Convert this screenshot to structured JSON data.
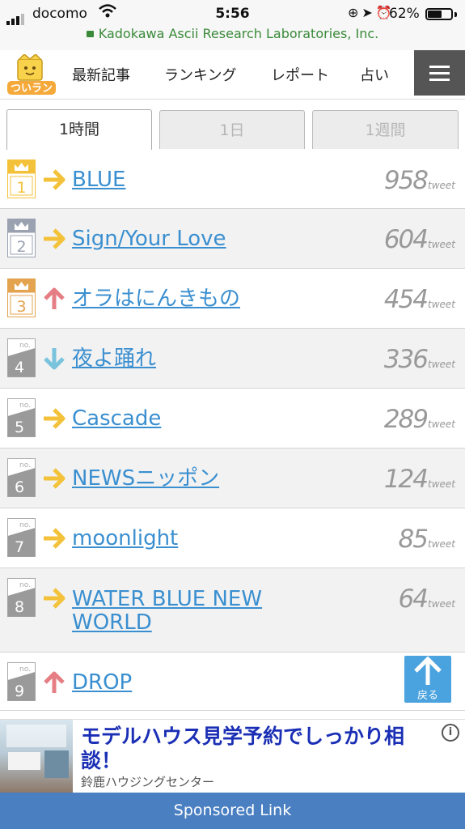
{
  "status_bar": {
    "carrier": "docomo",
    "time": "5:56",
    "battery_percent": "62%",
    "battery_level": 0.62,
    "url": "Kadokawa Ascii Research Laboratories, Inc."
  },
  "nav": {
    "logo_text": "ついラン",
    "items": [
      {
        "label": "最新記事"
      },
      {
        "label": "ランキング"
      },
      {
        "label": "レポート"
      },
      {
        "label": "占い"
      }
    ],
    "menu_icon": "hamburger-icon"
  },
  "tabs": [
    {
      "label": "1時間",
      "active": true
    },
    {
      "label": "1日",
      "active": false
    },
    {
      "label": "1週間",
      "active": false
    }
  ],
  "ranking": {
    "unit": "tweet",
    "rows": [
      {
        "rank": "1",
        "trend": "same",
        "title": "BLUE",
        "count": "958"
      },
      {
        "rank": "2",
        "trend": "same",
        "title": "Sign/Your Love",
        "count": "604"
      },
      {
        "rank": "3",
        "trend": "up",
        "title": "オラはにんきもの",
        "count": "454"
      },
      {
        "rank": "4",
        "trend": "down",
        "title": "夜よ踊れ",
        "count": "336"
      },
      {
        "rank": "5",
        "trend": "same",
        "title": "Cascade",
        "count": "289"
      },
      {
        "rank": "6",
        "trend": "same",
        "title": "NEWSニッポン",
        "count": "124"
      },
      {
        "rank": "7",
        "trend": "same",
        "title": "moonlight",
        "count": "85"
      },
      {
        "rank": "8",
        "trend": "same",
        "title": "WATER BLUE NEW WORLD",
        "count": "64"
      },
      {
        "rank": "9",
        "trend": "up",
        "title": "DROP",
        "count": ""
      }
    ],
    "badge_no_label": "no."
  },
  "back_button": {
    "label": "戻る"
  },
  "ad": {
    "headline": "モデルハウス見学予約でしっかり相談！",
    "sponsor": "鈴鹿ハウジングセンター",
    "info_icon": "info-icon"
  },
  "footer": {
    "label": "Sponsored Link"
  },
  "colors": {
    "link": "#3a8fd0",
    "trend_same": "#f3c23a",
    "trend_up": "#e57e84",
    "trend_down": "#79c3dd",
    "gold": "#f3c23a",
    "silver": "#9aa1b0",
    "bronze": "#e3a34f",
    "nav_menu": "#555555",
    "sponsored_bar": "#4a7fc2"
  }
}
